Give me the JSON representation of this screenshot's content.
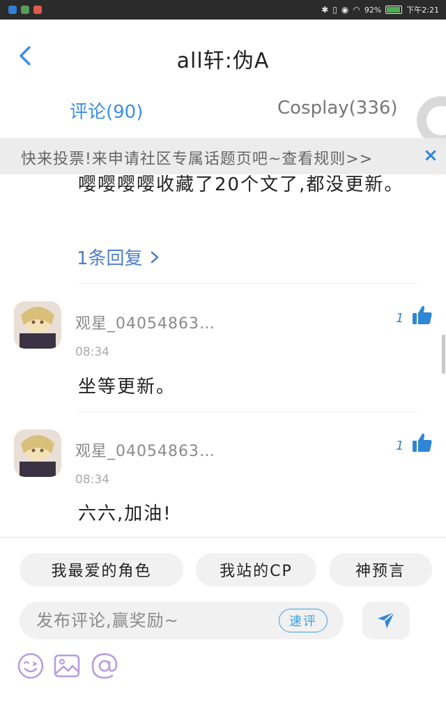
{
  "status_bar": {
    "battery": "92%",
    "battery_level": 0.92,
    "time": "下午2:21",
    "icons": [
      "bluetooth-icon",
      "vibrate-icon",
      "eye-icon",
      "wifi-icon",
      "battery-icon"
    ],
    "app_icons": [
      "shield-app-icon",
      "green-app-icon",
      "red-app-icon"
    ]
  },
  "header": {
    "title": "all轩:伪A",
    "back_icon": "chevron-left-icon"
  },
  "tabs": {
    "comments": "评论(90)",
    "cosplay": "Cosplay(336)"
  },
  "banner": {
    "text": "快来投票!来申请社区专属话题页吧~查看规则>>",
    "close": "×"
  },
  "previous_comment": {
    "text": "嘤嘤嘤嘤收藏了20个文了,都没更新。",
    "replies_link": "1条回复"
  },
  "comments": [
    {
      "username": "观星_04054863…",
      "time": "08:34",
      "text": "坐等更新。",
      "likes": "1"
    },
    {
      "username": "观星_04054863…",
      "time": "08:34",
      "text": "六六,加油!",
      "likes": "1"
    }
  ],
  "quick_chips": [
    "我最爱的角色",
    "我站的CP",
    "神预言"
  ],
  "input": {
    "placeholder": "发布评论,赢奖励~",
    "quick_review": "速评"
  },
  "tools": [
    "emoji-icon",
    "image-icon",
    "at-icon"
  ],
  "colors": {
    "accent": "#3a8ee6",
    "reply_link": "#4f7fc6",
    "like": "#2f86d6",
    "tool_purple": "#b59be0"
  }
}
